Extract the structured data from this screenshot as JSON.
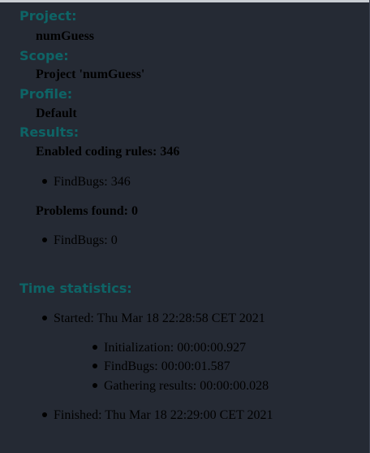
{
  "sections": {
    "project": {
      "heading": "Project:",
      "value": "numGuess"
    },
    "scope": {
      "heading": "Scope:",
      "value": "Project 'numGuess'"
    },
    "profile": {
      "heading": "Profile:",
      "value": "Default"
    },
    "results": {
      "heading": "Results:",
      "enabled_rules": "Enabled coding rules: 346",
      "enabled_items": [
        "FindBugs: 346"
      ],
      "problems_found": "Problems found: 0",
      "problem_items": [
        "FindBugs: 0"
      ]
    },
    "time_statistics": {
      "heading": "Time statistics:",
      "started": "Started: Thu Mar 18 22:28:58 CET 2021",
      "phases": [
        "Initialization: 00:00:00.927",
        "FindBugs: 00:00:01.587",
        "Gathering results: 00:00:00.028"
      ],
      "finished": "Finished: Thu Mar 18 22:29:00 CET 2021"
    }
  },
  "colors": {
    "background": "#252a34",
    "heading": "#0e6466",
    "text": "#000000"
  }
}
